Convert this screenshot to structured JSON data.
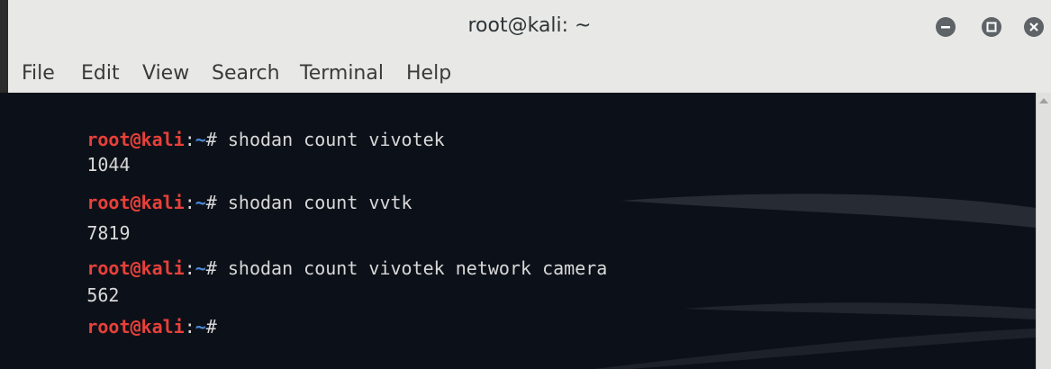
{
  "window": {
    "title": "root@kali: ~",
    "controls": {
      "minimize_icon": "minimize-icon",
      "maximize_icon": "maximize-icon",
      "close_icon": "close-icon"
    }
  },
  "menu": {
    "items": [
      "File",
      "Edit",
      "View",
      "Search",
      "Terminal",
      "Help"
    ]
  },
  "terminal": {
    "prompt_user": "root@kali",
    "prompt_sep": ":",
    "prompt_path": "~",
    "prompt_symbol": "# ",
    "lines": [
      {
        "type": "command",
        "text": "shodan count vivotek"
      },
      {
        "type": "output",
        "text": "1044"
      },
      {
        "type": "command",
        "text": "shodan count vvtk"
      },
      {
        "type": "output",
        "text": "7819"
      },
      {
        "type": "command",
        "text": "shodan count vivotek network camera"
      },
      {
        "type": "output",
        "text": "562"
      },
      {
        "type": "command",
        "text": ""
      }
    ]
  },
  "colors": {
    "prompt_user": "#e8403a",
    "prompt_path": "#4a8bd8",
    "terminal_bg": "#0c1119",
    "text": "#d8d8d8"
  }
}
